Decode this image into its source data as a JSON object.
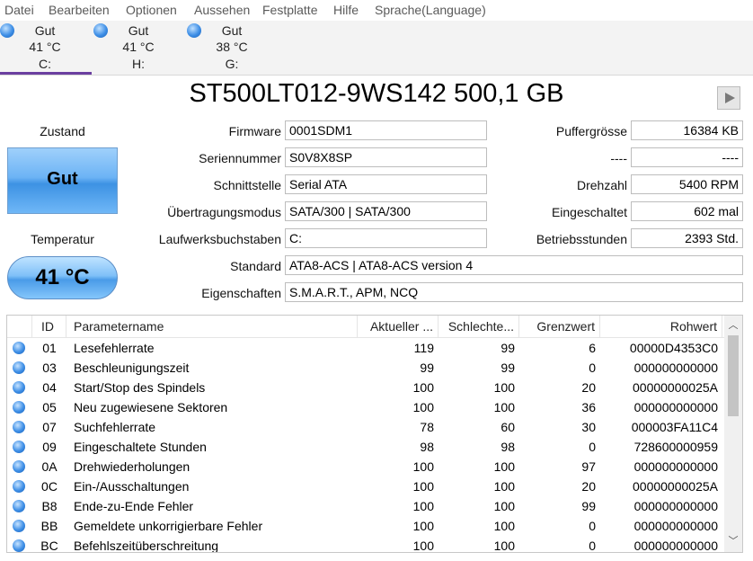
{
  "menu": [
    "Datei",
    "Bearbeiten",
    "Optionen",
    "Aussehen",
    "Festplatte",
    "Hilfe",
    "Sprache(Language)"
  ],
  "drives": [
    {
      "status": "Gut",
      "temp": "41 °C",
      "letter": "C:"
    },
    {
      "status": "Gut",
      "temp": "41 °C",
      "letter": "H:"
    },
    {
      "status": "Gut",
      "temp": "38 °C",
      "letter": "G:"
    }
  ],
  "title": "ST500LT012-9WS142 500,1 GB",
  "health": {
    "label": "Zustand",
    "value": "Gut"
  },
  "temperature": {
    "label": "Temperatur",
    "value": "41 °C"
  },
  "fields": {
    "firmware": {
      "label": "Firmware",
      "value": "0001SDM1"
    },
    "serial": {
      "label": "Seriennummer",
      "value": "S0V8X8SP"
    },
    "interface": {
      "label": "Schnittstelle",
      "value": "Serial ATA"
    },
    "transfer": {
      "label": "Übertragungsmodus",
      "value": "SATA/300 | SATA/300"
    },
    "letters": {
      "label": "Laufwerksbuchstaben",
      "value": "C:"
    },
    "standard": {
      "label": "Standard",
      "value": "ATA8-ACS | ATA8-ACS version 4"
    },
    "features": {
      "label": "Eigenschaften",
      "value": "S.M.A.R.T., APM, NCQ"
    },
    "buffer": {
      "label": "Puffergrösse",
      "value": "16384 KB"
    },
    "blank": {
      "label": "----",
      "value": "----"
    },
    "rpm": {
      "label": "Drehzahl",
      "value": "5400 RPM"
    },
    "power_count": {
      "label": "Eingeschaltet",
      "value": "602 mal"
    },
    "power_hours": {
      "label": "Betriebsstunden",
      "value": "2393 Std."
    }
  },
  "table": {
    "headers": [
      "ID",
      "Parametername",
      "Aktueller ...",
      "Schlechte...",
      "Grenzwert",
      "Rohwert"
    ],
    "rows": [
      [
        "01",
        "Lesefehlerrate",
        "119",
        "99",
        "6",
        "00000D4353C0"
      ],
      [
        "03",
        "Beschleunigungszeit",
        "99",
        "99",
        "0",
        "000000000000"
      ],
      [
        "04",
        "Start/Stop des Spindels",
        "100",
        "100",
        "20",
        "00000000025A"
      ],
      [
        "05",
        "Neu zugewiesene Sektoren",
        "100",
        "100",
        "36",
        "000000000000"
      ],
      [
        "07",
        "Suchfehlerrate",
        "78",
        "60",
        "30",
        "000003FA11C4"
      ],
      [
        "09",
        "Eingeschaltete Stunden",
        "98",
        "98",
        "0",
        "728600000959"
      ],
      [
        "0A",
        "Drehwiederholungen",
        "100",
        "100",
        "97",
        "000000000000"
      ],
      [
        "0C",
        "Ein-/Ausschaltungen",
        "100",
        "100",
        "20",
        "00000000025A"
      ],
      [
        "B8",
        "Ende-zu-Ende Fehler",
        "100",
        "100",
        "99",
        "000000000000"
      ],
      [
        "BB",
        "Gemeldete unkorrigierbare Fehler",
        "100",
        "100",
        "0",
        "000000000000"
      ],
      [
        "BC",
        "Befehlszeitüberschreitung",
        "100",
        "100",
        "0",
        "000000000000"
      ]
    ]
  },
  "colors": {
    "good": "#3d92e3",
    "tab_underline": "#6b3fa0"
  },
  "icons": {
    "status_dot": "blue-dot-icon",
    "play": "play-icon",
    "scroll_up": "chevron-up-icon",
    "scroll_down": "chevron-down-icon"
  }
}
